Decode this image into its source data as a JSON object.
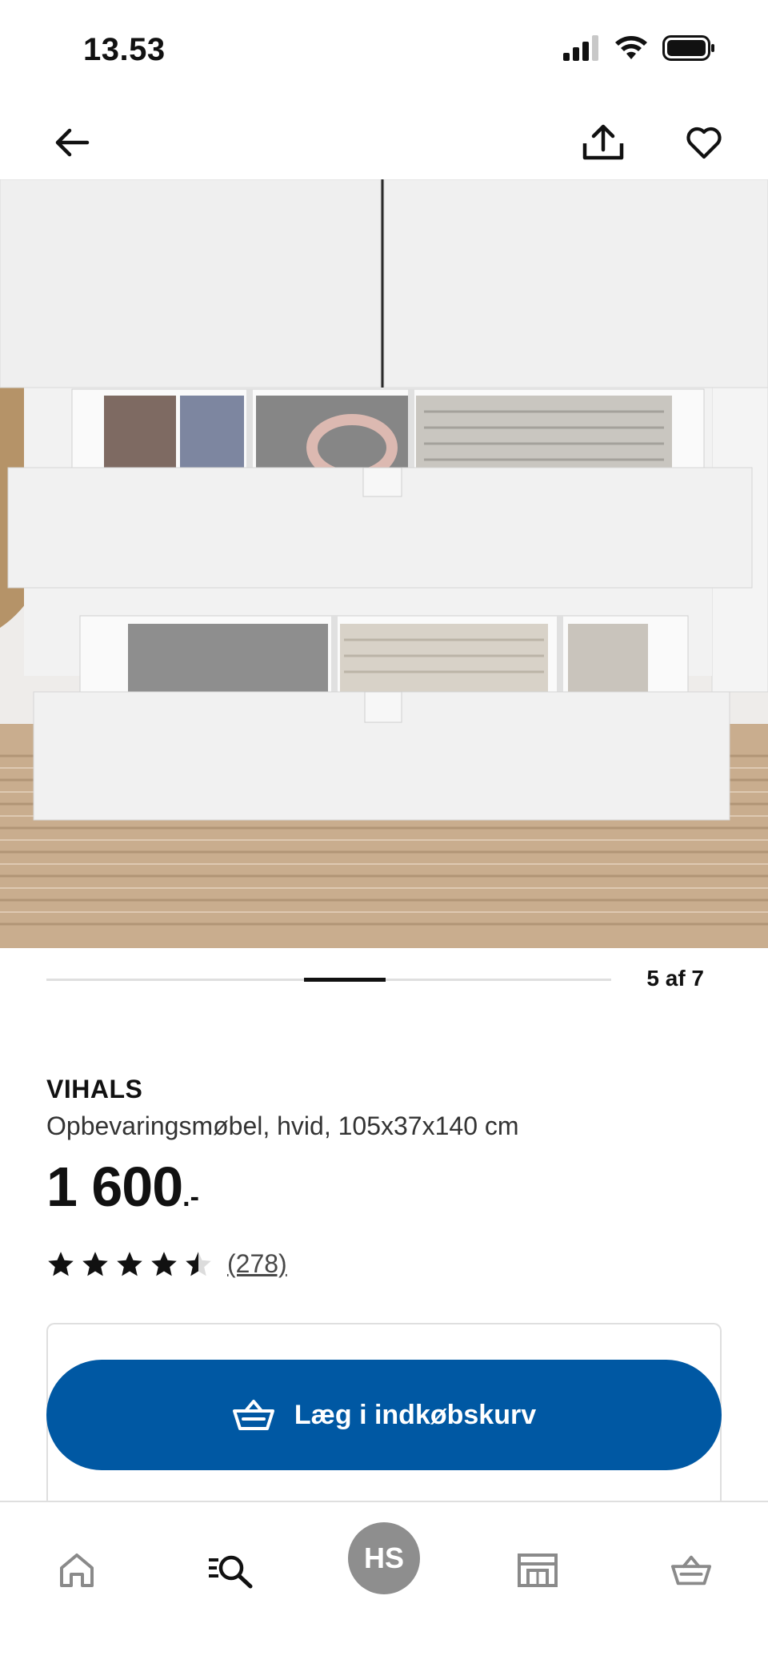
{
  "status_bar": {
    "time": "13.53"
  },
  "icons": {
    "back": "arrow-left-icon",
    "share": "share-icon",
    "favorite": "heart-icon",
    "cart": "basket-icon",
    "home": "home-icon",
    "search": "search-icon",
    "store": "store-icon"
  },
  "carousel": {
    "counter": "5 af 7",
    "current": 5,
    "total": 7
  },
  "product": {
    "name": "VIHALS",
    "description": "Opbevaringsmøbel, hvid, 105x37x140 cm",
    "price_integer": "1 600",
    "price_decimal": ".-",
    "rating": 4.5,
    "rating_max": 5,
    "review_count": "(278)"
  },
  "actions": {
    "add_to_cart_label": "Læg i indkøbskurv"
  },
  "bottom_nav": {
    "profile_initials": "HS"
  },
  "colors": {
    "primary_button": "#0058a3",
    "avatar_bg": "#8e8e8e",
    "text": "#111111"
  }
}
